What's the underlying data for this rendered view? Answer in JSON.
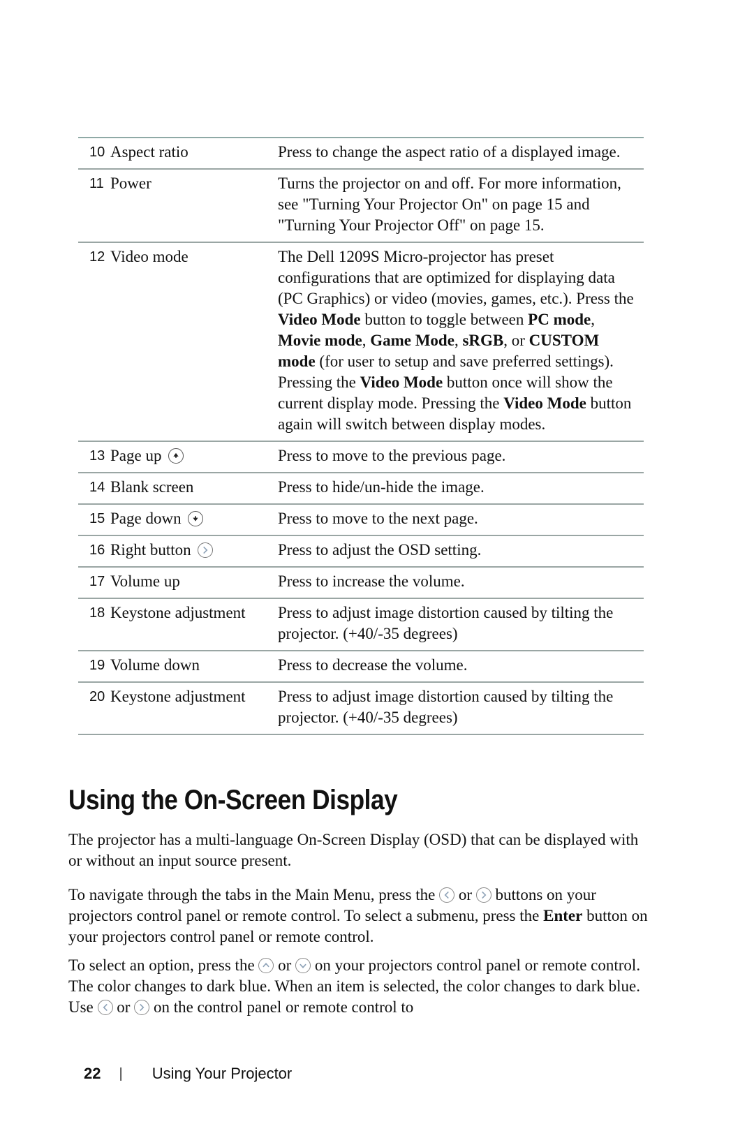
{
  "table": {
    "rows": [
      {
        "num": "10",
        "name": "Aspect ratio",
        "desc": "Press to change the aspect ratio of a displayed image."
      },
      {
        "num": "11",
        "name": "Power",
        "desc": "Turns the projector on and off. For more information, see \"Turning Your Projector On\" on page 15 and \"Turning Your Projector Off\" on page 15."
      },
      {
        "num": "12",
        "name": "Video mode",
        "desc_parts": [
          "The Dell 1209S Micro-projector has preset configurations that are optimized for displaying data (PC Graphics) or video (movies, games, etc.). Press the ",
          "Video Mode",
          " button to toggle between ",
          "PC mode",
          ", ",
          "Movie mode",
          ", ",
          "Game Mode",
          ", ",
          "sRGB",
          ", or ",
          "CUSTOM mode",
          " (for user to setup and save preferred settings). Pressing the ",
          "Video Mode",
          " button once will show the current display mode. Pressing the ",
          "Video Mode",
          " button again will switch between display modes."
        ]
      },
      {
        "num": "13",
        "name": "Page up",
        "icon": "page-up-icon",
        "desc": "Press to move to the previous page."
      },
      {
        "num": "14",
        "name": "Blank screen",
        "desc": "Press to hide/un-hide the image."
      },
      {
        "num": "15",
        "name": "Page down",
        "icon": "page-down-icon",
        "desc": "Press to move to the next page."
      },
      {
        "num": "16",
        "name": "Right button",
        "icon": "right-button-icon",
        "desc": "Press to adjust the OSD setting."
      },
      {
        "num": "17",
        "name": "Volume up",
        "desc": "Press to increase the volume."
      },
      {
        "num": "18",
        "name": "Keystone adjustment",
        "desc": "Press to adjust image distortion caused by tilting the projector. (+40/-35 degrees)"
      },
      {
        "num": "19",
        "name": "Volume down",
        "desc": "Press to decrease the volume."
      },
      {
        "num": "20",
        "name": "Keystone adjustment",
        "desc": "Press to adjust image distortion caused by tilting the projector. (+40/-35 degrees)"
      }
    ]
  },
  "section": {
    "heading": "Using the On-Screen Display",
    "p1": "The projector has a multi-language On-Screen Display (OSD) that can be displayed with or without an input source present.",
    "p2": {
      "a": "To navigate through the tabs in the Main Menu, press the ",
      "or": " or ",
      "b": " buttons on your projectors control panel or remote control. To select a submenu, press the ",
      "enter": "Enter",
      "c": " button on your projectors control panel or remote control."
    },
    "p3": {
      "a": "To select an option, press the ",
      "or1": " or ",
      "b": " on your projectors control panel or remote control. The color changes to dark blue. When an item is selected, the color changes to dark blue. Use ",
      "or2": " or ",
      "c": " on the control panel or remote control to"
    }
  },
  "footer": {
    "page_number": "22",
    "separator": "|",
    "section_title": "Using Your Projector"
  },
  "colors": {
    "rule": "#8fa9a6",
    "icon_chevron": "#8fa3b8",
    "text": "#111111"
  }
}
